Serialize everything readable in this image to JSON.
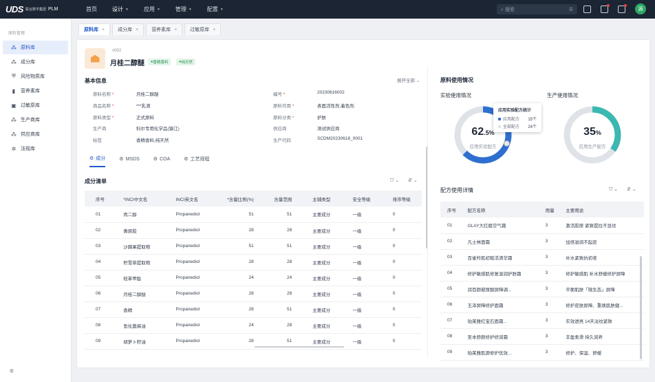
{
  "brand": {
    "mark": "UDS",
    "cn_line1": "联合数字集团",
    "cn_line2": "",
    "product": "PLM"
  },
  "topnav": [
    {
      "label": "首页",
      "active": false,
      "caret": false
    },
    {
      "label": "设计",
      "active": true,
      "caret": true
    },
    {
      "label": "应用",
      "active": false,
      "caret": true
    },
    {
      "label": "管理",
      "active": false,
      "caret": true
    },
    {
      "label": "配置",
      "active": false,
      "caret": true
    }
  ],
  "search": {
    "placeholder": "搜索"
  },
  "user": {
    "avatar": "源"
  },
  "sidebar": {
    "title": "原料管理",
    "items": [
      {
        "label": "原料库",
        "icon": "cluster-icon",
        "active": true
      },
      {
        "label": "成分库",
        "icon": "cluster-icon",
        "active": false
      },
      {
        "label": "风险物质库",
        "icon": "shield-icon",
        "active": false
      },
      {
        "label": "营养素库",
        "icon": "bottle-icon",
        "active": false
      },
      {
        "label": "过敏原库",
        "icon": "lock-icon",
        "active": false
      },
      {
        "label": "生产商库",
        "icon": "cluster-icon",
        "active": false
      },
      {
        "label": "供应商库",
        "icon": "cluster-icon",
        "active": false
      },
      {
        "label": "法规库",
        "icon": "gear-icon",
        "active": false
      }
    ]
  },
  "tabs": [
    {
      "label": "原料库",
      "active": true
    },
    {
      "label": "成分库",
      "active": false
    },
    {
      "label": "营养素库",
      "active": false
    },
    {
      "label": "过敏原库",
      "active": false
    }
  ],
  "material": {
    "code": "#002",
    "name": "月桂二醇醚",
    "tags": [
      "香精香料",
      "纯天然"
    ]
  },
  "basic_info": {
    "title": "基本信息",
    "expand": "展开全部",
    "fields_left": [
      {
        "label": "原料名称",
        "required": true,
        "value": "月桂二醇醚"
      },
      {
        "label": "商品名称",
        "required": true,
        "value": "***乳液"
      },
      {
        "label": "原料类型",
        "required": true,
        "value": "正式原料"
      },
      {
        "label": "生产商",
        "required": false,
        "value": "科尔专用化学品(镇江)"
      },
      {
        "label": "标签",
        "required": false,
        "value": "香精香料,纯天然"
      }
    ],
    "fields_right": [
      {
        "label": "编号",
        "required": true,
        "value": "20230616002"
      },
      {
        "label": "原料作用",
        "required": true,
        "value": "表面活性剂,着色剂"
      },
      {
        "label": "原料分类",
        "required": true,
        "value": "护肤"
      },
      {
        "label": "供应商",
        "required": false,
        "value": "测试供应商"
      },
      {
        "label": "生产代码",
        "required": false,
        "value": "SCDM20230616_0001"
      }
    ]
  },
  "subtabs": [
    {
      "label": "成分",
      "active": true
    },
    {
      "label": "MSDS",
      "active": false
    },
    {
      "label": "COA",
      "active": false
    },
    {
      "label": "工艺规程",
      "active": false
    }
  ],
  "composition": {
    "title": "成分清单",
    "headers": [
      "序号",
      "*INCI中文名",
      "INCI英文名",
      "*含量比例(%)",
      "含量范围",
      "主辅类型",
      "安全等级",
      "排序等级"
    ],
    "rows": [
      [
        "01",
        "丙二醇",
        "Propanediol",
        "51",
        "51",
        "主要成分",
        "一级",
        "0"
      ],
      [
        "02",
        "黄原胶",
        "Propanediol",
        "28",
        "28",
        "主要成分",
        "一级",
        "0"
      ],
      [
        "03",
        "沙棘果提取物",
        "Propanediol",
        "51",
        "51",
        "主要成分",
        "一级",
        "0"
      ],
      [
        "04",
        "积雪草提取物",
        "Propanediol",
        "28",
        "28",
        "主要成分",
        "一级",
        "0"
      ],
      [
        "05",
        "羟苯甲酯",
        "Propanediol",
        "24",
        "24",
        "主要成分",
        "一级",
        "0"
      ],
      [
        "06",
        "月桂二醇醚",
        "Propanediol",
        "28",
        "28",
        "主要成分",
        "一级",
        "0"
      ],
      [
        "07",
        "香精",
        "Propanediol",
        "28",
        "51",
        "主要成分",
        "一级",
        "0"
      ],
      [
        "08",
        "氢化蓖麻油",
        "Propanediol",
        "24",
        "28",
        "主要成分",
        "一级",
        "0"
      ],
      [
        "09",
        "胡萝卜籽油",
        "Propanediol",
        "28",
        "51",
        "主要成分",
        "一级",
        "0"
      ]
    ]
  },
  "usage": {
    "title": "原料使用情况",
    "lab": {
      "title": "实验使用情况",
      "percent": "62",
      "unit": ".5%",
      "fraction": 0.625,
      "sub": "应用实验配方",
      "color": "#2f6fd0"
    },
    "prod": {
      "title": "生产使用情况",
      "percent": "35",
      "unit": "%",
      "fraction": 0.35,
      "sub": "应用生产配方",
      "color": "#3cb7b1"
    },
    "tooltip": {
      "title": "应用实验配方统计",
      "rows": [
        {
          "label": "应用配方",
          "value": "15个",
          "color": "#2f6fd0"
        },
        {
          "label": "全部配方",
          "value": "24个",
          "color": "#dfe3e8"
        }
      ]
    }
  },
  "formula": {
    "title": "配方使用详情",
    "headers": [
      "序号",
      "配方名称",
      "用量",
      "主要用途"
    ],
    "rows": [
      [
        "01",
        "OLAY大红瓶空气霜",
        "3",
        "激活胶原 紧致提拉不显纹"
      ],
      [
        "02",
        "凡士林面霜",
        "3",
        "加倍滋润不起皮"
      ],
      [
        "03",
        "百雀羚肌初赋活清华霜",
        "3",
        "补水紧致抗初老"
      ],
      [
        "04",
        "修护敏感肌修复滋润护肤霜",
        "3",
        "修护敏感肌 补水舒缓修护屏障"
      ],
      [
        "05",
        "润百颜玻尿酸屏障调...",
        "3",
        "平衡肌肤「微生态」屏障"
      ],
      [
        "06",
        "玉泽屏障修护面霜",
        "3",
        "修护皮肤屏障、重焕肌肤健..."
      ],
      [
        "07",
        "珀莱雅红宝石面霜...",
        "3",
        "实效透亮 14天淡纹紧致"
      ],
      [
        "08",
        "至本舒颜修护修润霜",
        "3",
        "丰盈柔滑 持久润养"
      ],
      [
        "09",
        "珀莱雅肌源修护优效...",
        "3",
        "修护、保湿、舒缓"
      ]
    ]
  }
}
